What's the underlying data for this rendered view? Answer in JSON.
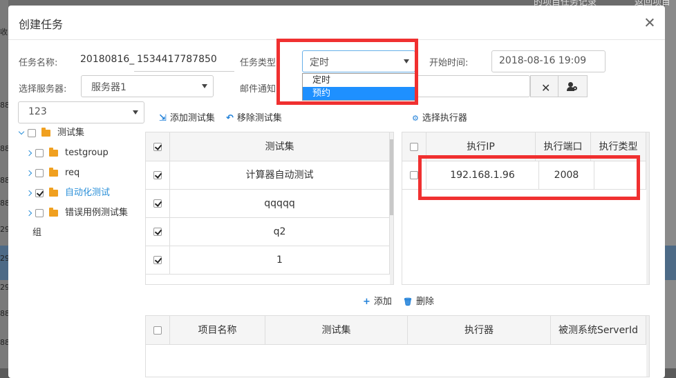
{
  "background": {
    "top_right_text": "的项目任务记录",
    "top_right_text2": "返回项目",
    "left_ticks": [
      "收",
      "88",
      "88",
      "88",
      "88",
      "29",
      "29",
      "29",
      "88",
      "88"
    ]
  },
  "modal": {
    "title": "创建任务",
    "close_icon": "close-icon"
  },
  "form": {
    "task_name_label": "任务名称:",
    "task_name_prefix": "20180816_",
    "task_name_value": "1534417787850",
    "task_type_label": "任务类型:",
    "task_type_value": "定时",
    "task_type_options": [
      "定时",
      "预约"
    ],
    "task_type_highlighted": "预约",
    "start_time_label": "开始时间:",
    "start_time_value": "2018-08-16 19:09",
    "server_label": "选择服务器:",
    "server_value": "服务器1",
    "mail_label": "邮件通知:",
    "clear_icon": "x-icon",
    "user_settings_icon": "user-gear-icon"
  },
  "project_select": {
    "value": "123"
  },
  "tree": {
    "items": [
      {
        "label": "测试集",
        "expanded": true,
        "checked": false,
        "level": 0
      },
      {
        "label": "testgroup",
        "expanded": false,
        "checked": false,
        "level": 1
      },
      {
        "label": "req",
        "expanded": false,
        "checked": false,
        "level": 1
      },
      {
        "label": "自动化测试",
        "expanded": false,
        "checked": true,
        "level": 1,
        "active": true
      },
      {
        "label": "错误用例测试集",
        "expanded": false,
        "checked": false,
        "level": 1
      }
    ],
    "footer": "组"
  },
  "actions": {
    "add_testset": "添加测试集",
    "remove_testset": "移除测试集",
    "select_executor": "选择执行器",
    "add": "添加",
    "delete": "删除"
  },
  "testset_table": {
    "header": "测试集",
    "rows": [
      {
        "name": "计算器自动测试",
        "checked": true
      },
      {
        "name": "qqqqq",
        "checked": true
      },
      {
        "name": "q2",
        "checked": true
      },
      {
        "name": "1",
        "checked": true
      }
    ]
  },
  "executor_table": {
    "headers": [
      "执行IP",
      "执行端口",
      "执行类型"
    ],
    "rows": [
      {
        "ip": "192.168.1.96",
        "port": "2008",
        "type": ""
      }
    ]
  },
  "bottom_table": {
    "headers": [
      "项目名称",
      "测试集",
      "执行器",
      "被测系统ServerId"
    ]
  },
  "colors": {
    "accent": "#1e90ff",
    "highlight_box": "#f03030",
    "folder": "#f0a020"
  }
}
